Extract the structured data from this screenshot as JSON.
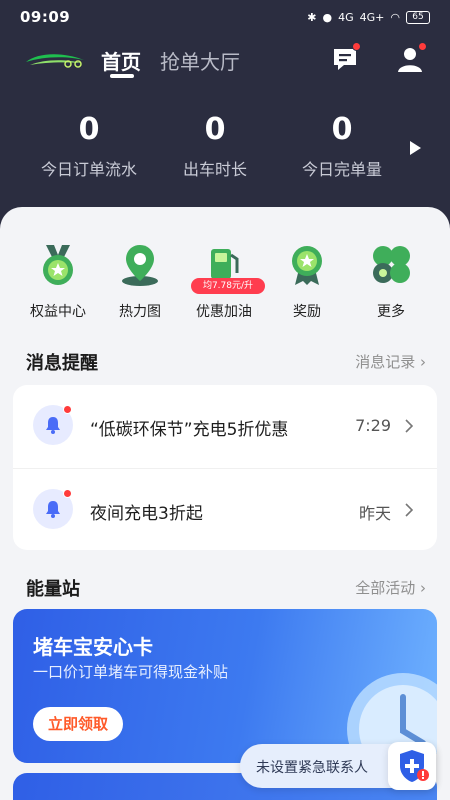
{
  "status_bar": {
    "time": "09:09",
    "network": "4G",
    "network2": "4G+",
    "battery": "65"
  },
  "nav": {
    "tab_home": "首页",
    "tab_hall": "抢单大厅"
  },
  "stats": [
    {
      "value": "0",
      "label": "今日订单流水"
    },
    {
      "value": "0",
      "label": "出车时长"
    },
    {
      "value": "0",
      "label": "今日完单量"
    }
  ],
  "quick_actions": [
    {
      "label": "权益中心",
      "icon": "medal-icon"
    },
    {
      "label": "热力图",
      "icon": "map-pin-icon"
    },
    {
      "label": "优惠加油",
      "icon": "fuel-pump-icon",
      "badge": "均7.78元/升"
    },
    {
      "label": "奖励",
      "icon": "reward-badge-icon"
    },
    {
      "label": "更多",
      "icon": "more-grid-icon"
    }
  ],
  "messages": {
    "title": "消息提醒",
    "link": "消息记录",
    "items": [
      {
        "text": "“低碳环保节”充电5折优惠",
        "time": "7:29"
      },
      {
        "text": "夜间充电3折起",
        "time": "昨天"
      }
    ]
  },
  "energy": {
    "title": "能量站",
    "link": "全部活动",
    "banner_title": "堵车宝安心卡",
    "banner_subtitle": "一口价订单堵车可得现金补贴",
    "banner_button": "立即领取"
  },
  "emergency": {
    "text": "未设置紧急联系人"
  },
  "colors": {
    "header_bg": "#2b2d40",
    "accent_blue": "#2f5fe6",
    "badge_red": "#ff3d4f",
    "button_orange": "#ff5a2a"
  }
}
